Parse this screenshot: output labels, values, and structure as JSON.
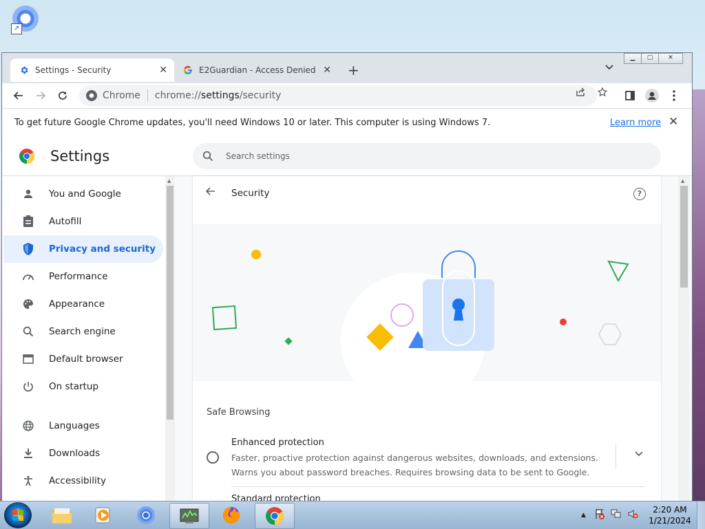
{
  "browser": {
    "tabs": [
      {
        "title": "Settings - Security",
        "active": true,
        "favicon": "gear-icon"
      },
      {
        "title": "E2Guardian - Access Denied",
        "active": false,
        "favicon": "google-g-icon"
      }
    ],
    "omnibox": {
      "site_label": "Chrome",
      "url_prefix": "chrome://",
      "url_host": "settings",
      "url_path": "/security"
    },
    "infobar": {
      "message": "To get future Google Chrome updates, you'll need Windows 10 or later. This computer is using Windows 7.",
      "link": "Learn more"
    }
  },
  "settings": {
    "title": "Settings",
    "search_placeholder": "Search settings",
    "nav": [
      {
        "label": "You and Google",
        "icon": "person-icon",
        "selected": false
      },
      {
        "label": "Autofill",
        "icon": "clipboard-icon",
        "selected": false
      },
      {
        "label": "Privacy and security",
        "icon": "shield-icon",
        "selected": true
      },
      {
        "label": "Performance",
        "icon": "speedometer-icon",
        "selected": false
      },
      {
        "label": "Appearance",
        "icon": "palette-icon",
        "selected": false
      },
      {
        "label": "Search engine",
        "icon": "search-icon",
        "selected": false
      },
      {
        "label": "Default browser",
        "icon": "browser-window-icon",
        "selected": false
      },
      {
        "label": "On startup",
        "icon": "power-icon",
        "selected": false
      },
      {
        "label": "Languages",
        "icon": "globe-icon",
        "selected": false
      },
      {
        "label": "Downloads",
        "icon": "download-icon",
        "selected": false
      },
      {
        "label": "Accessibility",
        "icon": "accessibility-icon",
        "selected": false
      }
    ],
    "section": {
      "title": "Security",
      "safe_browsing_label": "Safe Browsing",
      "options": [
        {
          "title": "Enhanced protection",
          "description": "Faster, proactive protection against dangerous websites, downloads, and extensions. Warns you about password breaches. Requires browsing data to be sent to Google.",
          "selected": false
        },
        {
          "title": "Standard protection",
          "selected": false
        }
      ]
    }
  },
  "taskbar": {
    "time": "2:20 AM",
    "date": "1/21/2024"
  },
  "colors": {
    "accent": "#1a73e8",
    "selected_nav_bg": "#e8f0fe",
    "selected_nav_text": "#1967d2"
  }
}
